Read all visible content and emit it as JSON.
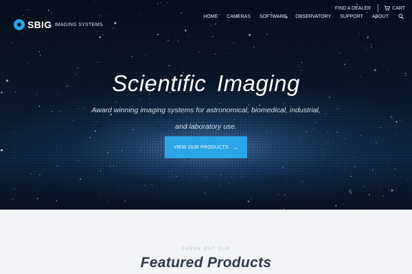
{
  "brand": {
    "name": "SBIG",
    "subtitle": "IMAGING SYSTEMS",
    "accent": "#2aa5e8"
  },
  "utility_nav": {
    "find_dealer": "FIND A DEALER",
    "cart": "CART"
  },
  "main_nav": {
    "items": [
      {
        "label": "HOME"
      },
      {
        "label": "CAMERAS"
      },
      {
        "label": "SOFTWARE"
      },
      {
        "label": "OBSERVATORY"
      },
      {
        "label": "SUPPORT"
      },
      {
        "label": "ABOUT"
      }
    ],
    "search_icon": "search-icon"
  },
  "hero": {
    "headline": "Scientific  Imaging",
    "tagline": "Award winning imaging systems for astronomical, biomedical, industrial, and laboratory use.",
    "cta_label": "VIEW OUR PRODUCTS",
    "cta_arrow": "→"
  },
  "featured": {
    "eyebrow": "CHECK OUT OUR",
    "title": "Featured Products"
  }
}
